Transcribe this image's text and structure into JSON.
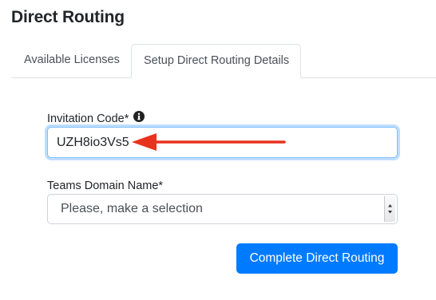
{
  "page_title": "Direct Routing",
  "tabs": [
    {
      "label": "Available Licenses",
      "active": false
    },
    {
      "label": "Setup Direct Routing Details",
      "active": true
    }
  ],
  "invitation_code": {
    "label": "Invitation Code*",
    "value": "UZH8io3Vs5",
    "info_icon": "info-circle-icon"
  },
  "teams_domain": {
    "label": "Teams Domain Name*",
    "selected": "Please, make a selection"
  },
  "submit_button": {
    "label": "Complete Direct Routing"
  },
  "colors": {
    "primary": "#007bff",
    "annotation_arrow": "#e8321e"
  }
}
